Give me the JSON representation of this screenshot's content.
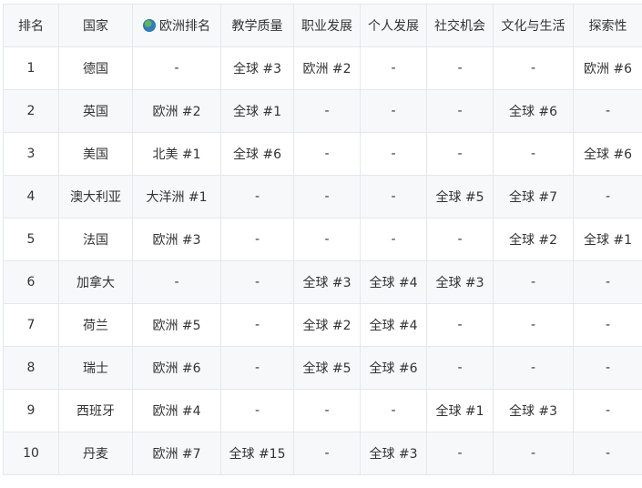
{
  "table": {
    "headers": {
      "rank": "排名",
      "country": "国家",
      "europe_rank": "欧洲排名",
      "teaching": "教学质量",
      "career": "职业发展",
      "personal": "个人发展",
      "social": "社交机会",
      "culture": "文化与生活",
      "exploration": "探索性"
    },
    "europe_rank_icon": "globe-icon",
    "rows": [
      {
        "rank": "1",
        "country": "德国",
        "europe_rank": "-",
        "teaching": "全球 #3",
        "career": "欧洲 #2",
        "personal": "-",
        "social": "-",
        "culture": "-",
        "exploration": "欧洲 #6"
      },
      {
        "rank": "2",
        "country": "英国",
        "europe_rank": "欧洲 #2",
        "teaching": "全球 #1",
        "career": "-",
        "personal": "-",
        "social": "-",
        "culture": "全球 #6",
        "exploration": "-"
      },
      {
        "rank": "3",
        "country": "美国",
        "europe_rank": "北美 #1",
        "teaching": "全球 #6",
        "career": "-",
        "personal": "-",
        "social": "-",
        "culture": "-",
        "exploration": "全球 #6"
      },
      {
        "rank": "4",
        "country": "澳大利亚",
        "europe_rank": "大洋洲 #1",
        "teaching": "-",
        "career": "-",
        "personal": "-",
        "social": "全球 #5",
        "culture": "全球 #7",
        "exploration": "-"
      },
      {
        "rank": "5",
        "country": "法国",
        "europe_rank": "欧洲 #3",
        "teaching": "-",
        "career": "-",
        "personal": "-",
        "social": "-",
        "culture": "全球 #2",
        "exploration": "全球 #1"
      },
      {
        "rank": "6",
        "country": "加拿大",
        "europe_rank": "-",
        "teaching": "-",
        "career": "全球 #3",
        "personal": "全球 #4",
        "social": "全球 #3",
        "culture": "-",
        "exploration": "-"
      },
      {
        "rank": "7",
        "country": "荷兰",
        "europe_rank": "欧洲 #5",
        "teaching": "-",
        "career": "全球 #2",
        "personal": "全球 #4",
        "social": "-",
        "culture": "-",
        "exploration": "-"
      },
      {
        "rank": "8",
        "country": "瑞士",
        "europe_rank": "欧洲 #6",
        "teaching": "-",
        "career": "全球 #5",
        "personal": "全球 #6",
        "social": "-",
        "culture": "-",
        "exploration": "-"
      },
      {
        "rank": "9",
        "country": "西班牙",
        "europe_rank": "欧洲 #4",
        "teaching": "-",
        "career": "-",
        "personal": "-",
        "social": "全球 #1",
        "culture": "全球 #3",
        "exploration": "-"
      },
      {
        "rank": "10",
        "country": "丹麦",
        "europe_rank": "欧洲 #7",
        "teaching": "全球 #15",
        "career": "-",
        "personal": "全球 #3",
        "social": "-",
        "culture": "-",
        "exploration": "-"
      }
    ]
  }
}
